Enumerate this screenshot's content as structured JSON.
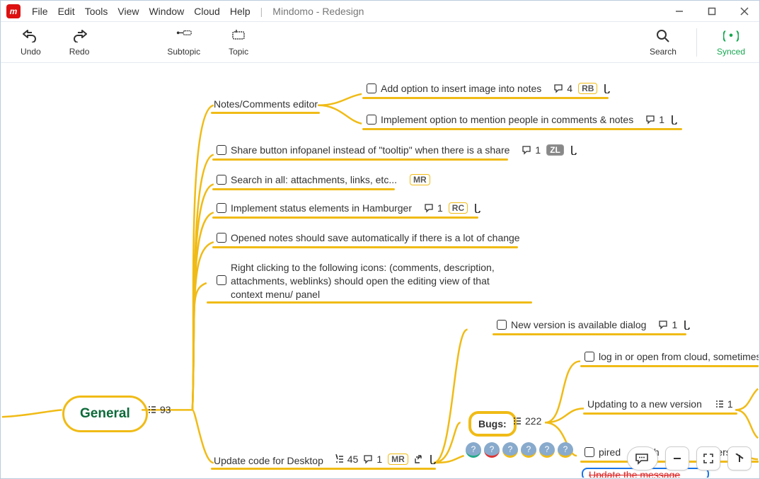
{
  "app": {
    "icon_glyph": "m",
    "doc_title": "Mindomo - Redesign"
  },
  "menu": {
    "file": "File",
    "edit": "Edit",
    "tools": "Tools",
    "view": "View",
    "window": "Window",
    "cloud": "Cloud",
    "help": "Help"
  },
  "toolbar": {
    "undo": "Undo",
    "redo": "Redo",
    "subtopic": "Subtopic",
    "topic": "Topic",
    "search": "Search",
    "synced": "Synced"
  },
  "root": {
    "label": "General",
    "count": "93"
  },
  "branch": {
    "notes_editor": "Notes/Comments editor"
  },
  "nodes": {
    "n1": {
      "text": "Add option to insert image into notes",
      "comments": "4",
      "tag": "RB"
    },
    "n2": {
      "text": "Implement option to mention people in comments & notes",
      "comments": "1"
    },
    "n3": {
      "text": "Share button infopanel instead of \"tooltip\" when there is a share",
      "comments": "1",
      "tag": "ZL"
    },
    "n4": {
      "text": "Search in all: attachments, links, etc...",
      "tag": "MR"
    },
    "n5": {
      "text": "Implement status elements in Hamburger",
      "comments": "1",
      "tag": "RC"
    },
    "n6": {
      "text": "Opened notes should save automatically if there is a lot of change"
    },
    "n7": {
      "text": "Right clicking to the following icons: (comments, description, attachments, weblinks) should open the editing view of that context menu/ panel"
    },
    "n8": {
      "text": "New version is available dialog",
      "comments": "1"
    },
    "n9": {
      "text": "log in or open from cloud, sometimes"
    },
    "n10": {
      "text": "Updating to a new version",
      "count": "1"
    },
    "n11": {
      "text": "pired",
      "mid": "e h",
      "tail": "ersi"
    },
    "n12": {
      "text": "Update the message"
    },
    "desktop": {
      "text": "Update code for Desktop",
      "count": "45",
      "comments": "1",
      "tag": "MR"
    }
  },
  "bugs": {
    "label": "Bugs:",
    "count": "222"
  }
}
